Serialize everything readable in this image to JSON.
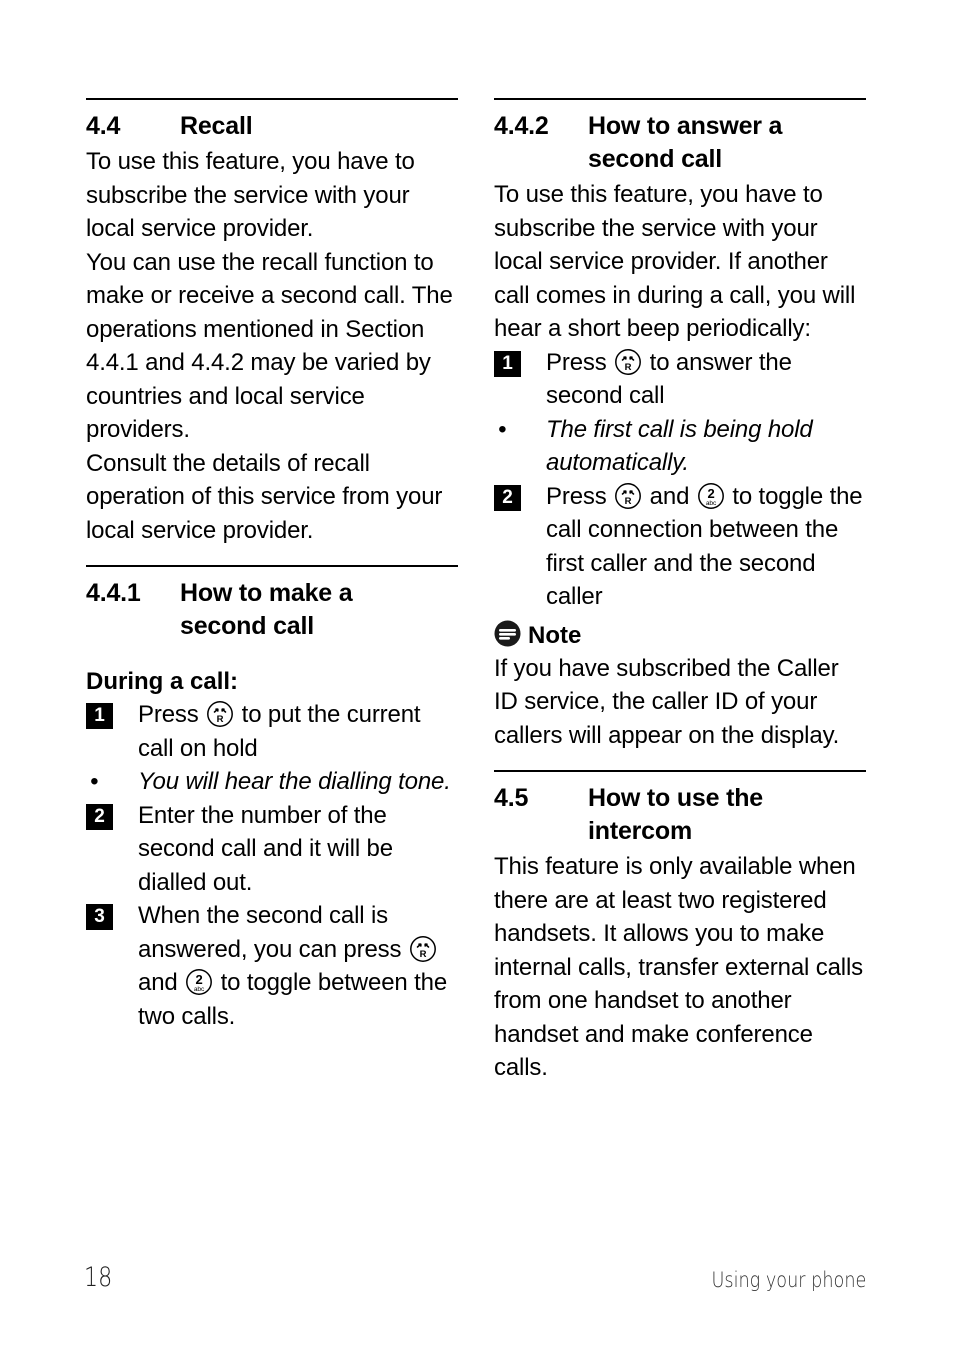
{
  "page": {
    "number": "18",
    "footer_label": "Using your phone",
    "background_color": "#ffffff",
    "text_color": "#000000"
  },
  "icons": {
    "recall_key": {
      "name": "recall-key-icon",
      "label": "R",
      "description": "circle with two small arrows above letter R"
    },
    "two_key": {
      "name": "two-abc-key-icon",
      "digit": "2",
      "letters": "abc",
      "description": "circle with digit 2 above abc"
    },
    "note": {
      "name": "note-icon",
      "description": "solid black circle with white horizontal lines"
    }
  },
  "left_column": {
    "section_4_4": {
      "number": "4.4",
      "title": "Recall",
      "paragraphs": [
        "To use this feature, you have to subscribe the service with your local service provider.",
        "You can use the recall function to make or receive a second call. The operations mentioned in Section 4.4.1 and 4.4.2 may be varied by countries and local service providers.",
        "Consult the details of recall operation of this service from your local service provider."
      ]
    },
    "section_4_4_1": {
      "number": "4.4.1",
      "title_line1": "How to make a",
      "title_line2": "second call",
      "subheading": "During a call:",
      "steps": [
        {
          "marker": "1",
          "type": "numbered",
          "text_before": "Press",
          "icon": "recall_key",
          "text_after": "to put the current call on hold"
        },
        {
          "marker": "•",
          "type": "bullet",
          "italic": true,
          "text": "You will hear the dialling tone."
        },
        {
          "marker": "2",
          "type": "numbered",
          "text": "Enter the number of the second call and it will be dialled out."
        },
        {
          "marker": "3",
          "type": "numbered",
          "text_before": "When the second call is answered, you can press",
          "icon": "recall_key",
          "text_middle": "and",
          "icon2": "two_key",
          "text_after": "to toggle between the two calls."
        }
      ]
    }
  },
  "right_column": {
    "section_4_4_2": {
      "number": "4.4.2",
      "title_line1": "How to answer a",
      "title_line2": "second call",
      "paragraph": "To use this feature, you have to subscribe the service with your local service provider. If another call comes in during a call, you will hear a short beep periodically:",
      "steps": [
        {
          "marker": "1",
          "type": "numbered",
          "text_before": "Press",
          "icon": "recall_key",
          "text_after": "to answer the second call"
        },
        {
          "marker": "•",
          "type": "bullet",
          "italic": true,
          "text": "The first call is being hold automatically."
        },
        {
          "marker": "2",
          "type": "numbered",
          "text_before": "Press",
          "icon": "recall_key",
          "text_middle": "and",
          "icon2": "two_key",
          "text_after": "to toggle the call connection between the first caller and the second caller"
        }
      ],
      "note": {
        "label": "Note",
        "text": "If you have subscribed the Caller ID service, the caller ID of your callers will appear on the display."
      }
    },
    "section_4_5": {
      "number": "4.5",
      "title_line1": "How to use the",
      "title_line2": "intercom",
      "paragraph": "This feature is only available when there are at least two registered handsets. It allows you to make internal calls, transfer external calls from one handset to another handset and make conference calls."
    }
  }
}
